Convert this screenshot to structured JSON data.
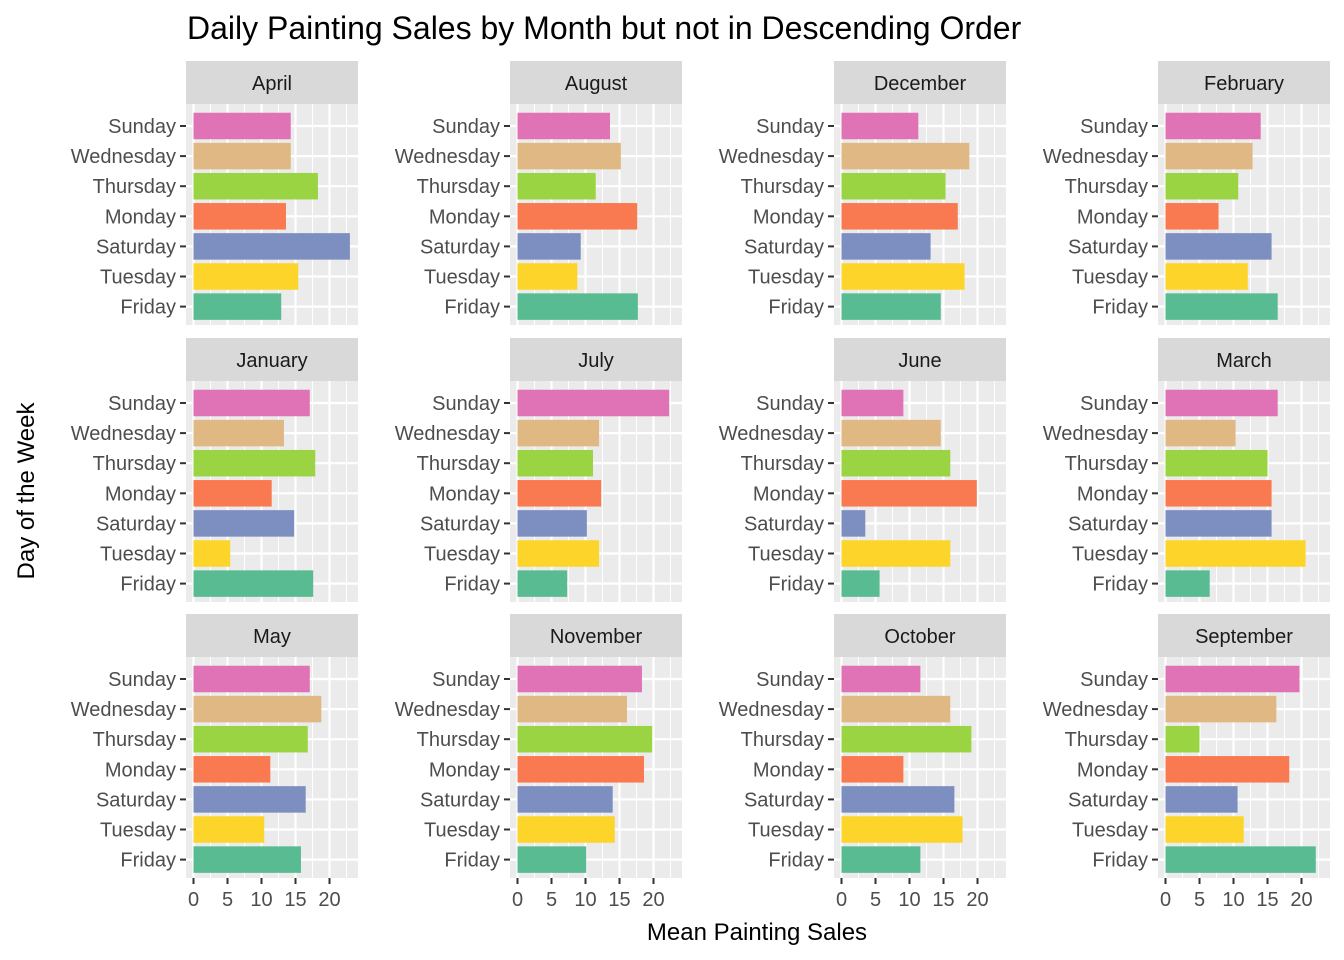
{
  "chart_data": {
    "type": "bar",
    "orientation": "horizontal",
    "title": "Daily Painting Sales by Month but not in Descending Order",
    "xlabel": "Mean Painting Sales",
    "ylabel": "Day of the Week",
    "xlim": [
      0,
      24
    ],
    "x_ticks": [
      0,
      5,
      10,
      15,
      20
    ],
    "grid": true,
    "legend": "none",
    "facet_layout": {
      "rows": 3,
      "cols": 4
    },
    "categories": [
      "Sunday",
      "Wednesday",
      "Thursday",
      "Monday",
      "Saturday",
      "Tuesday",
      "Friday"
    ],
    "colors": {
      "Sunday": "#e072b6",
      "Wednesday": "#dfb883",
      "Thursday": "#9ad443",
      "Monday": "#f97a50",
      "Saturday": "#7d8ec1",
      "Tuesday": "#fdd429",
      "Friday": "#58bb92"
    },
    "panels": [
      {
        "month": "April",
        "values": [
          14.3,
          14.3,
          18.3,
          13.6,
          23.0,
          15.4,
          12.9
        ]
      },
      {
        "month": "August",
        "values": [
          13.6,
          15.2,
          11.5,
          17.6,
          9.3,
          8.8,
          17.7
        ]
      },
      {
        "month": "December",
        "values": [
          11.3,
          18.8,
          15.3,
          17.1,
          13.1,
          18.1,
          14.6
        ]
      },
      {
        "month": "February",
        "values": [
          14.0,
          12.8,
          10.7,
          7.8,
          15.6,
          12.1,
          16.5
        ]
      },
      {
        "month": "January",
        "values": [
          17.1,
          13.3,
          17.9,
          11.5,
          14.8,
          5.4,
          17.6
        ]
      },
      {
        "month": "July",
        "values": [
          22.3,
          12.0,
          11.1,
          12.3,
          10.2,
          12.0,
          7.3
        ]
      },
      {
        "month": "June",
        "values": [
          9.1,
          14.6,
          16.0,
          19.9,
          3.5,
          16.0,
          5.6
        ]
      },
      {
        "month": "March",
        "values": [
          16.5,
          10.3,
          15.0,
          15.6,
          15.6,
          20.6,
          6.5
        ]
      },
      {
        "month": "May",
        "values": [
          17.1,
          18.8,
          16.8,
          11.3,
          16.5,
          10.4,
          15.8
        ]
      },
      {
        "month": "November",
        "values": [
          18.3,
          16.1,
          19.8,
          18.6,
          14.0,
          14.3,
          10.1
        ]
      },
      {
        "month": "October",
        "values": [
          11.6,
          16.0,
          19.1,
          9.1,
          16.6,
          17.8,
          11.6
        ]
      },
      {
        "month": "September",
        "values": [
          19.7,
          16.3,
          5.0,
          18.2,
          10.6,
          11.5,
          22.1
        ]
      }
    ]
  }
}
